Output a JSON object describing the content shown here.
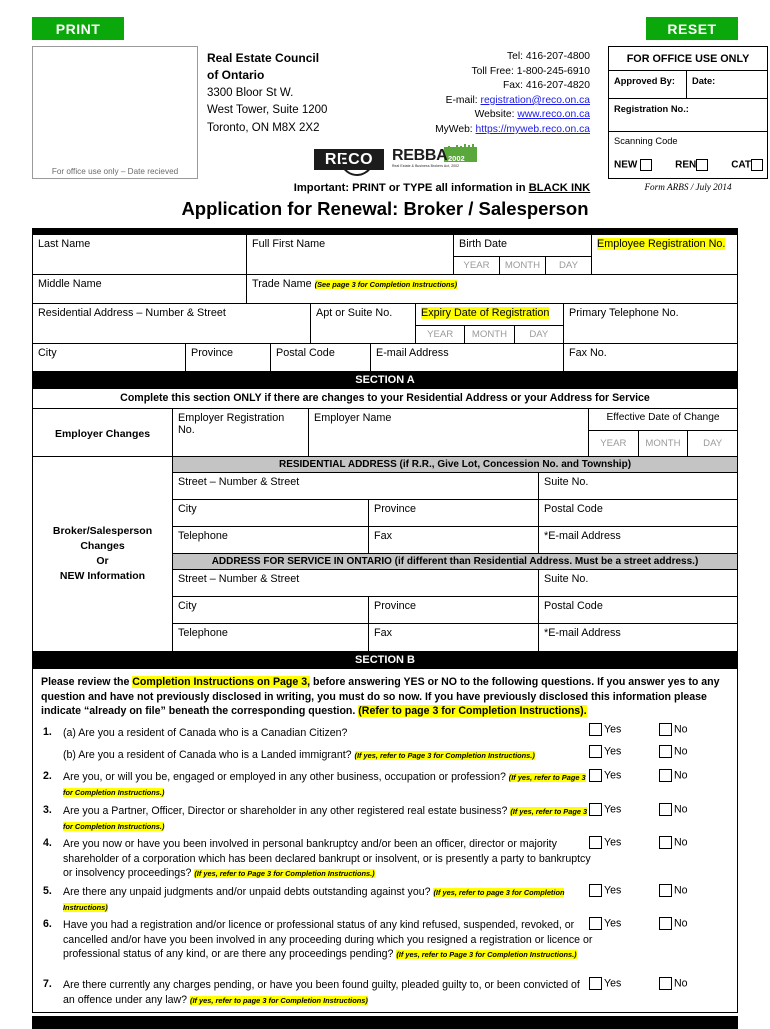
{
  "buttons": {
    "print": "PRINT",
    "reset": "RESET"
  },
  "header": {
    "datebox_caption": "For office use only – Date recieved",
    "org_line1": "Real Estate Council",
    "org_line2": "of Ontario",
    "org_line3": "3300 Bloor St W.",
    "org_line4": "West Tower, Suite 1200",
    "org_line5": "Toronto, ON  M8X 2X2",
    "tel": "Tel: 416-207-4800",
    "toll_free": "Toll Free: 1-800-245-6910",
    "fax": "Fax: 416-207-4820",
    "email_label": "E-mail:",
    "email_value": "registration@reco.on.ca",
    "website_label": "Website:",
    "website_value": "www.reco.on.ca",
    "myweb_label": "MyWeb:",
    "myweb_value": "https://myweb.reco.on.ca",
    "logo_reco": "RECO",
    "logo_rebba": "REBBA",
    "logo_rebba_year": "2002",
    "logo_rebba_sub": "Real Estate & Business Brokers Act, 2002",
    "important": "Important: PRINT or TYPE all information in ",
    "important_underlined": "BLACK INK",
    "form_number": "Form ARBS / July 2014"
  },
  "office_use": {
    "title": "FOR OFFICE USE ONLY",
    "approved_by": "Approved By:",
    "date": "Date:",
    "registration_no": "Registration No.:",
    "scanning_code": "Scanning Code",
    "new": "NEW",
    "ren": "REN",
    "cat": "CAT"
  },
  "title": "Application for Renewal:  Broker / Salesperson",
  "identity": {
    "last_name": "Last Name",
    "full_first_name": "Full First Name",
    "birth_date": "Birth Date",
    "employee_registration_no": "Employee Registration No.",
    "middle_name": "Middle Name",
    "trade_name": "Trade Name ",
    "trade_name_note": "(See page 3 for Completion Instructions)",
    "residential_address": "Residential Address – Number & Street",
    "apt_or_suite_no": "Apt or Suite No.",
    "expiry_date": "Expiry Date of Registration",
    "primary_telephone_no": "Primary Telephone No.",
    "city": "City",
    "province": "Province",
    "postal_code": "Postal Code",
    "email_address": "E-mail Address",
    "fax_no": "Fax No.",
    "ymd": {
      "year": "YEAR",
      "month": "MONTH",
      "day": "DAY"
    }
  },
  "section_a": {
    "band": "SECTION A",
    "subtitle": "Complete this section ONLY if there are changes to your Residential Address or your Address for Service",
    "employer_changes": "Employer Changes",
    "employer_registration_no": "Employer Registration No.",
    "employer_name": "Employer Name",
    "effective_date_of_change": "Effective Date of Change",
    "side_label_1": "Broker/Salesperson",
    "side_label_2": "Changes",
    "side_label_3": "Or",
    "side_label_4": "NEW Information",
    "residential_header": "RESIDENTIAL ADDRESS (if R.R., Give Lot, Concession No. and Township)",
    "service_header": "ADDRESS FOR SERVICE IN ONTARIO (if different than Residential Address. Must be a street address.)",
    "street": "Street – Number & Street",
    "suite_no": "Suite No.",
    "city": "City",
    "province": "Province",
    "postal_code": "Postal Code",
    "telephone": "Telephone",
    "fax": "Fax",
    "email_address": "*E-mail Address"
  },
  "section_b": {
    "band": "SECTION B",
    "intro_1": "Please review the ",
    "intro_hl_1": "Completion Instructions on Page 3,",
    "intro_2": " before answering YES or NO to the following questions. If you answer yes to any question and have not previously disclosed in writing, you must do so now. If you have previously disclosed this information please indicate “already on file” beneath the corresponding question. ",
    "intro_hl_2": "(Refer to page 3 for Completion Instructions).",
    "yes": "Yes",
    "no": "No",
    "questions": [
      {
        "num": "1.",
        "lines": [
          {
            "text": "(a) Are you a resident of Canada who is a Canadian Citizen?",
            "note": ""
          },
          {
            "text": "(b) Are you a resident of Canada who is a Landed immigrant? ",
            "note": "(If yes, refer to Page 3 for Completion Instructions.)"
          }
        ]
      },
      {
        "num": "2.",
        "text": "Are you, or will you be, engaged or employed in any other business, occupation or profession? ",
        "note": "(If yes, refer to Page 3 for Completion Instructions.)"
      },
      {
        "num": "3.",
        "text": "Are you a Partner, Officer, Director or shareholder in any other registered real estate business? ",
        "note": "(If yes, refer to Page 3 for Completion Instructions.)"
      },
      {
        "num": "4.",
        "text": "Are you now or have you been involved in personal bankruptcy and/or been an officer, director or majority shareholder of a corporation which has been declared bankrupt or insolvent, or is presently a party to bankruptcy or insolvency proceedings? ",
        "note": "(If yes, refer to Page 3 for Completion Instructions.)"
      },
      {
        "num": "5.",
        "text": "Are there any unpaid judgments and/or unpaid debts outstanding against you? ",
        "note": "(If yes, refer to page 3 for Completion Instructions)"
      },
      {
        "num": "6.",
        "text": "Have you had a registration and/or licence or professional status of any kind refused, suspended, revoked, or cancelled and/or have you been involved in any proceeding during which you resigned a registration or licence or professional status of any kind, or are there any proceedings pending? ",
        "note": "(If yes, refer to Page 3 for Completion Instructions.)"
      },
      {
        "num": "7.",
        "text": "Are there currently any charges pending, or have you been found guilty, pleaded guilty to, or been convicted of an offence under any law? ",
        "note": "(If yes, refer to page 3 for Completion Instructions)"
      }
    ]
  },
  "colors": {
    "accent_green": "#0aa80a",
    "highlight": "#ffff00",
    "band": "#000000",
    "grey_header": "#c4c4c4"
  }
}
